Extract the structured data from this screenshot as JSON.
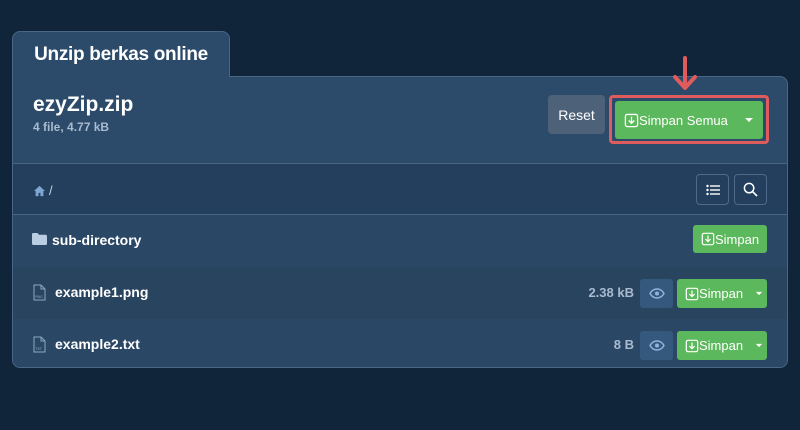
{
  "page": {
    "tab_title": "Unzip berkas online"
  },
  "archive": {
    "name": "ezyZip.zip",
    "info": "4 file, 4.77 kB",
    "reset_label": "Reset",
    "save_all_label": "Simpan Semua"
  },
  "toolbar": {
    "path": "/"
  },
  "files": [
    {
      "type": "folder",
      "name": "sub-directory",
      "size": "",
      "save_label": "Simpan"
    },
    {
      "type": "file",
      "icon_tag": "PNG",
      "name": "example1.png",
      "size": "2.38 kB",
      "save_label": "Simpan"
    },
    {
      "type": "file",
      "icon_tag": "TXT",
      "name": "example2.txt",
      "size": "8 B",
      "save_label": "Simpan"
    }
  ],
  "colors": {
    "background": "#10243a",
    "panel": "#2c4a6a",
    "success": "#5cb85c",
    "highlight": "#e05b5b",
    "reset": "#4d6279"
  },
  "icons": [
    "home-icon",
    "list-icon",
    "search-icon",
    "folder-icon",
    "file-icon",
    "eye-icon",
    "download-icon",
    "caret-down-icon",
    "arrow-down-icon"
  ]
}
